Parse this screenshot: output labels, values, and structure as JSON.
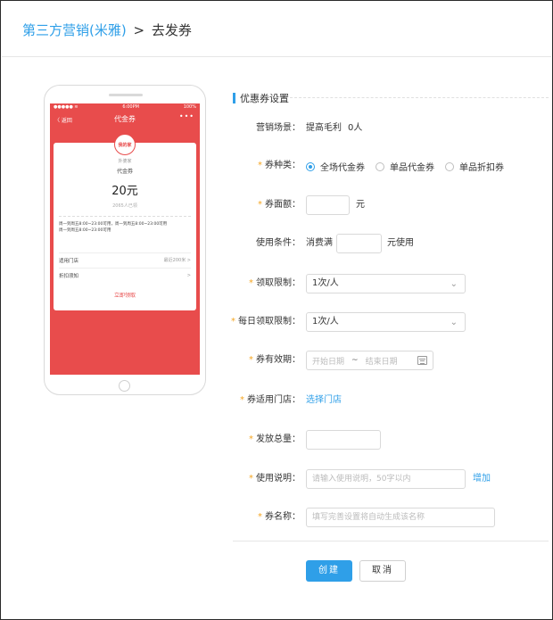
{
  "breadcrumb": {
    "link": "第三方营销(米雅)",
    "separator": ">",
    "current": "去发券"
  },
  "phone_preview": {
    "status_left": "●●●●● ≋",
    "status_time": "6:00PM",
    "status_battery": "100%",
    "back": "〈 返回",
    "title": "代金券",
    "more": "•••",
    "shop_logo_text": "我的家",
    "shop_name": "外婆家",
    "coupon_type": "代金券",
    "amount": "20元",
    "received": "2065人已领",
    "time_line1": "周一到周五8:00~23:00可用，周一到周五8:00~23:00可用",
    "time_line2": "周一到周五8:00~23:00可用",
    "store_label": "适用门店",
    "store_value": "最近200米 >",
    "discount_label": "折扣须知",
    "discount_chevron": ">",
    "claim_button": "立即领取"
  },
  "form": {
    "section_title": "优惠券设置",
    "scene_label": "营销场景：",
    "scene_value": "提高毛利",
    "scene_count": "0人",
    "type_label": "券种类：",
    "type_options": [
      "全场代金券",
      "单品代金券",
      "单品折扣券"
    ],
    "type_selected": 0,
    "amount_label": "券面额：",
    "amount_unit": "元",
    "condition_label": "使用条件：",
    "condition_prefix": "消费满",
    "condition_suffix": "元使用",
    "limit_label": "领取限制：",
    "limit_value": "1次/人",
    "daily_limit_label": "每日领取限制：",
    "daily_limit_value": "1次/人",
    "validity_label": "券有效期：",
    "start_placeholder": "开始日期",
    "range_sep": "~",
    "end_placeholder": "结束日期",
    "store_label": "券适用门店：",
    "store_link": "选择门店",
    "total_label": "发放总量：",
    "usage_label": "使用说明：",
    "usage_placeholder": "请输入使用说明，50字以内",
    "usage_add": "增加",
    "name_label": "券名称：",
    "name_placeholder": "填写完善设置将自动生成该名称",
    "required_mark": "*"
  },
  "actions": {
    "create": "创建",
    "cancel": "取消"
  },
  "colors": {
    "accent": "#2f9fe8",
    "coupon_red": "#e84c4c",
    "required": "#f5a623"
  }
}
